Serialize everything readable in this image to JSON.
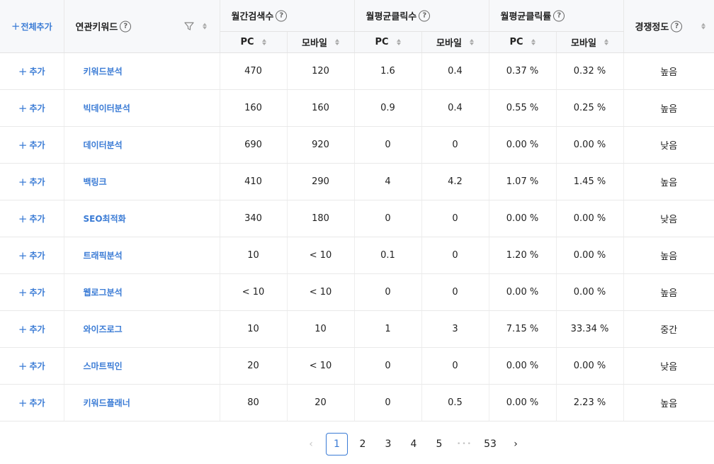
{
  "header": {
    "add_all": "전체추가",
    "keyword_col": "연관키워드",
    "groups": [
      "월간검색수",
      "월평균클릭수",
      "월평균클릭률"
    ],
    "competition": "경쟁정도",
    "sub": [
      "PC",
      "모바일",
      "PC",
      "모바일",
      "PC",
      "모바일"
    ],
    "help_glyph": "?"
  },
  "add_label": "추가",
  "rows": [
    {
      "keyword": "키워드분석",
      "s_pc": "470",
      "s_mo": "120",
      "c_pc": "1.6",
      "c_mo": "0.4",
      "r_pc": "0.37 %",
      "r_mo": "0.32 %",
      "comp": "높음"
    },
    {
      "keyword": "빅데이터분석",
      "s_pc": "160",
      "s_mo": "160",
      "c_pc": "0.9",
      "c_mo": "0.4",
      "r_pc": "0.55 %",
      "r_mo": "0.25 %",
      "comp": "높음"
    },
    {
      "keyword": "데이터분석",
      "s_pc": "690",
      "s_mo": "920",
      "c_pc": "0",
      "c_mo": "0",
      "r_pc": "0.00 %",
      "r_mo": "0.00 %",
      "comp": "낮음"
    },
    {
      "keyword": "백링크",
      "s_pc": "410",
      "s_mo": "290",
      "c_pc": "4",
      "c_mo": "4.2",
      "r_pc": "1.07 %",
      "r_mo": "1.45 %",
      "comp": "높음"
    },
    {
      "keyword": "SEO최적화",
      "s_pc": "340",
      "s_mo": "180",
      "c_pc": "0",
      "c_mo": "0",
      "r_pc": "0.00 %",
      "r_mo": "0.00 %",
      "comp": "낮음"
    },
    {
      "keyword": "트래픽분석",
      "s_pc": "10",
      "s_mo": "< 10",
      "c_pc": "0.1",
      "c_mo": "0",
      "r_pc": "1.20 %",
      "r_mo": "0.00 %",
      "comp": "높음"
    },
    {
      "keyword": "웹로그분석",
      "s_pc": "< 10",
      "s_mo": "< 10",
      "c_pc": "0",
      "c_mo": "0",
      "r_pc": "0.00 %",
      "r_mo": "0.00 %",
      "comp": "높음"
    },
    {
      "keyword": "와이즈로그",
      "s_pc": "10",
      "s_mo": "10",
      "c_pc": "1",
      "c_mo": "3",
      "r_pc": "7.15 %",
      "r_mo": "33.34 %",
      "comp": "중간"
    },
    {
      "keyword": "스마트픽인",
      "s_pc": "20",
      "s_mo": "< 10",
      "c_pc": "0",
      "c_mo": "0",
      "r_pc": "0.00 %",
      "r_mo": "0.00 %",
      "comp": "낮음"
    },
    {
      "keyword": "키워드플래너",
      "s_pc": "80",
      "s_mo": "20",
      "c_pc": "0",
      "c_mo": "0.5",
      "r_pc": "0.00 %",
      "r_mo": "2.23 %",
      "comp": "높음"
    }
  ],
  "pagination": {
    "prev": "‹",
    "pages": [
      "1",
      "2",
      "3",
      "4",
      "5"
    ],
    "ellipsis": "•••",
    "last": "53",
    "next": "›",
    "current": "1"
  },
  "colors": {
    "accent": "#3a7bd5",
    "header_bg": "#f7f8fa"
  }
}
